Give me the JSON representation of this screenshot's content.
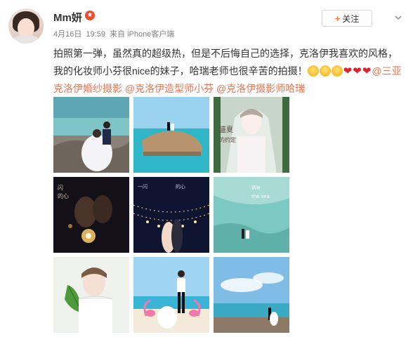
{
  "post": {
    "author": {
      "name": "Mm妍",
      "vip_badge": "★"
    },
    "meta": {
      "date": "4月16日",
      "time": "19:59",
      "source": "来自 iPhone客户端"
    },
    "follow_button": {
      "plus": "+",
      "label": "关注"
    },
    "text": {
      "body": "拍照第一弹，虽然真的超级热，但是不后悔自己的选择，克洛伊我喜欢的风格，我的化妆师小芬很nice的妹子，哈瑞老师也很辛苦的拍摄！",
      "emojis": [
        "fear-emoji",
        "fear-emoji",
        "fear-emoji",
        "heart-emoji",
        "heart-emoji",
        "heart-emoji"
      ],
      "heart_glyph": "❤",
      "mentions": [
        "@三亚克洛伊婚纱摄影",
        "@克洛伊造型师小芬",
        "@克洛伊摄影师哈瑞"
      ]
    },
    "photos": [
      {
        "name": "photo-couple-on-rocks"
      },
      {
        "name": "photo-couple-on-island-rock"
      },
      {
        "name": "photo-bride-veil-portrait",
        "caption_lines": [
          "盛夏",
          "的约定"
        ]
      },
      {
        "name": "photo-couple-sparklers-night",
        "caption_lines": [
          "闪",
          "的心"
        ]
      },
      {
        "name": "photo-couple-fairy-lights",
        "caption_lines": [
          "一闪",
          "的心"
        ]
      },
      {
        "name": "photo-couple-sea-aerial",
        "caption_lines": [
          "We",
          "the sea"
        ]
      },
      {
        "name": "photo-bride-leaf-portrait"
      },
      {
        "name": "photo-couple-flamingos-beach"
      },
      {
        "name": "photo-couple-coast-sky"
      }
    ],
    "colors": {
      "mention": "#eb7350",
      "vip": "#f0492f",
      "follow_plus": "#f77c3d"
    }
  }
}
